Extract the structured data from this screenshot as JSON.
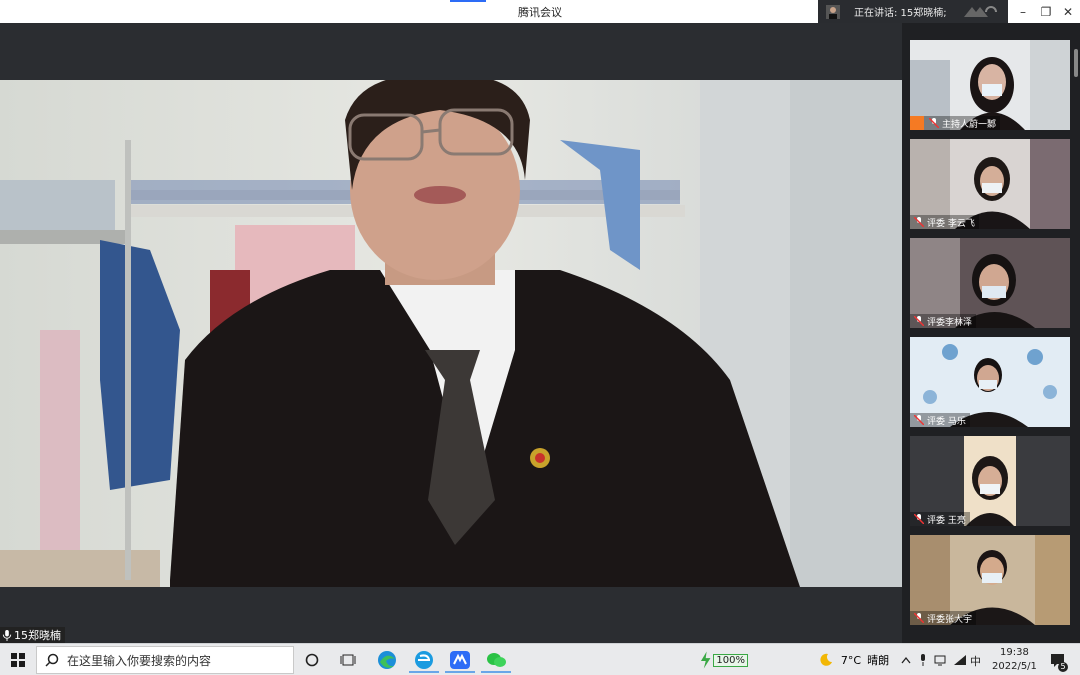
{
  "window": {
    "title": "腾讯会议",
    "speaking_label": "正在讲话: 15郑晓楠;",
    "minimize": "–",
    "restore": "❐",
    "close": "✕"
  },
  "main_speaker": {
    "name": "15郑晓楠"
  },
  "participants": [
    {
      "label": "主持人蔚一鄹",
      "is_host": true
    },
    {
      "label": "评委 李云飞",
      "is_host": false
    },
    {
      "label": "评委李林泽",
      "is_host": false
    },
    {
      "label": "评委 马乐",
      "is_host": false
    },
    {
      "label": "评委 王亮",
      "is_host": false
    },
    {
      "label": "评委张大宇",
      "is_host": false
    }
  ],
  "taskbar": {
    "search_placeholder": "在这里输入你要搜索的内容",
    "battery": "100%",
    "weather_temp": "7°C",
    "weather_text": "晴朗",
    "ime": "中",
    "time": "19:38",
    "date": "2022/5/1",
    "notifications": "5"
  },
  "colors": {
    "accent": "#2d6cf6",
    "host_badge": "#f57a23",
    "battery_green": "#3aa845"
  },
  "icons": [
    "windows-start-icon",
    "search-icon",
    "cortana-icon",
    "task-view-icon",
    "edge-icon",
    "ie-icon",
    "tencent-meeting-icon",
    "wechat-icon",
    "battery-icon",
    "moon-icon",
    "chevron-up-icon",
    "mic-icon",
    "network-icon",
    "wifi-icon",
    "notification-icon"
  ]
}
